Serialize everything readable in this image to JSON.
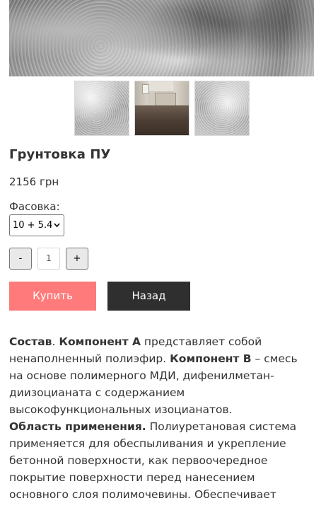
{
  "gallery": {
    "main_image": "product-surface-photo",
    "thumbnails": [
      "surface-closeup-1",
      "room-floor-photo",
      "surface-closeup-2"
    ]
  },
  "product": {
    "title": "Грунтовка ПУ",
    "price": "2156 грн"
  },
  "packaging": {
    "label": "Фасовка:",
    "selected": "10 + 5.4"
  },
  "quantity": {
    "minus_label": "-",
    "value": "1",
    "plus_label": "+"
  },
  "actions": {
    "buy_label": "Купить",
    "back_label": "Назад",
    "buy_color": "#ff7a7a",
    "back_color": "#2f2f2f"
  },
  "description": {
    "l1_b1": "Состав",
    "l1_t1": ". ",
    "l1_b2": "Компонент А",
    "l1_t2": " представляет собой",
    "l2_t1": "ненаполненный полиэфир. ",
    "l2_b1": "Компонент В",
    "l2_t2": " – смесь",
    "l3": "на основе полимерного МДИ, дифенилметан-",
    "l4": "диизоцианата с содержанием",
    "l5": "высокофункциональных изоцианатов.",
    "l6_b1": "Область применения.",
    "l6_t1": " Полиуретановая система",
    "l7": "применяется для обеспыливания и укрепление",
    "l8": "бетонной поверхности, как первоочередное",
    "l9": "покрытие поверхности перед нанесением",
    "l10": "основного слоя полимочевины. Обеспечивает"
  }
}
